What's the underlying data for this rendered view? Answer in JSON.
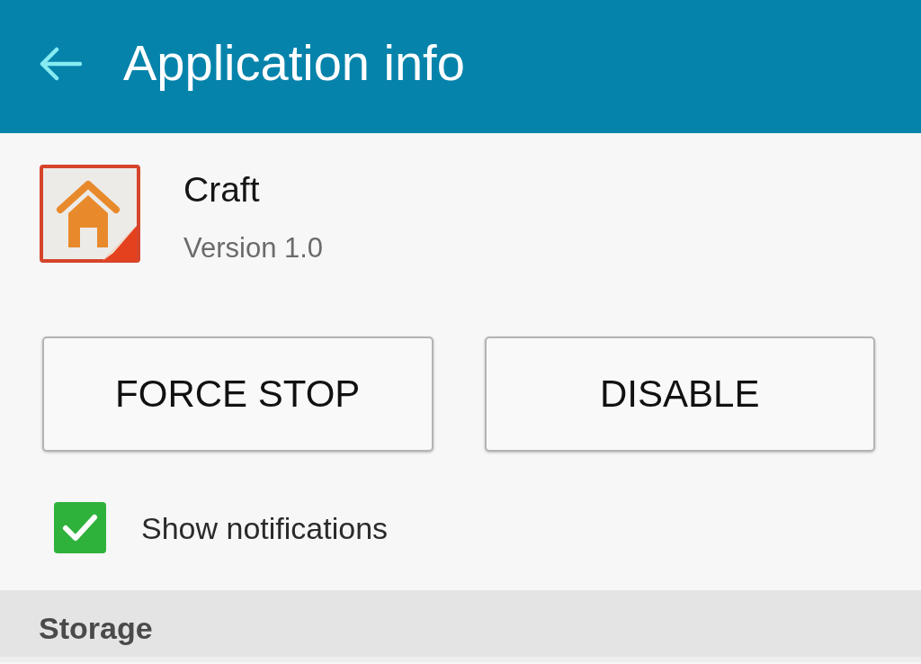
{
  "app_bar": {
    "title": "Application info"
  },
  "app": {
    "name": "Craft",
    "version": "Version 1.0"
  },
  "buttons": [
    {
      "label": "FORCE STOP"
    },
    {
      "label": "DISABLE"
    }
  ],
  "options": [
    {
      "kind": "checkbox",
      "label": "Show notifications",
      "checked": true
    }
  ],
  "sections": [
    {
      "title": "Storage"
    }
  ]
}
